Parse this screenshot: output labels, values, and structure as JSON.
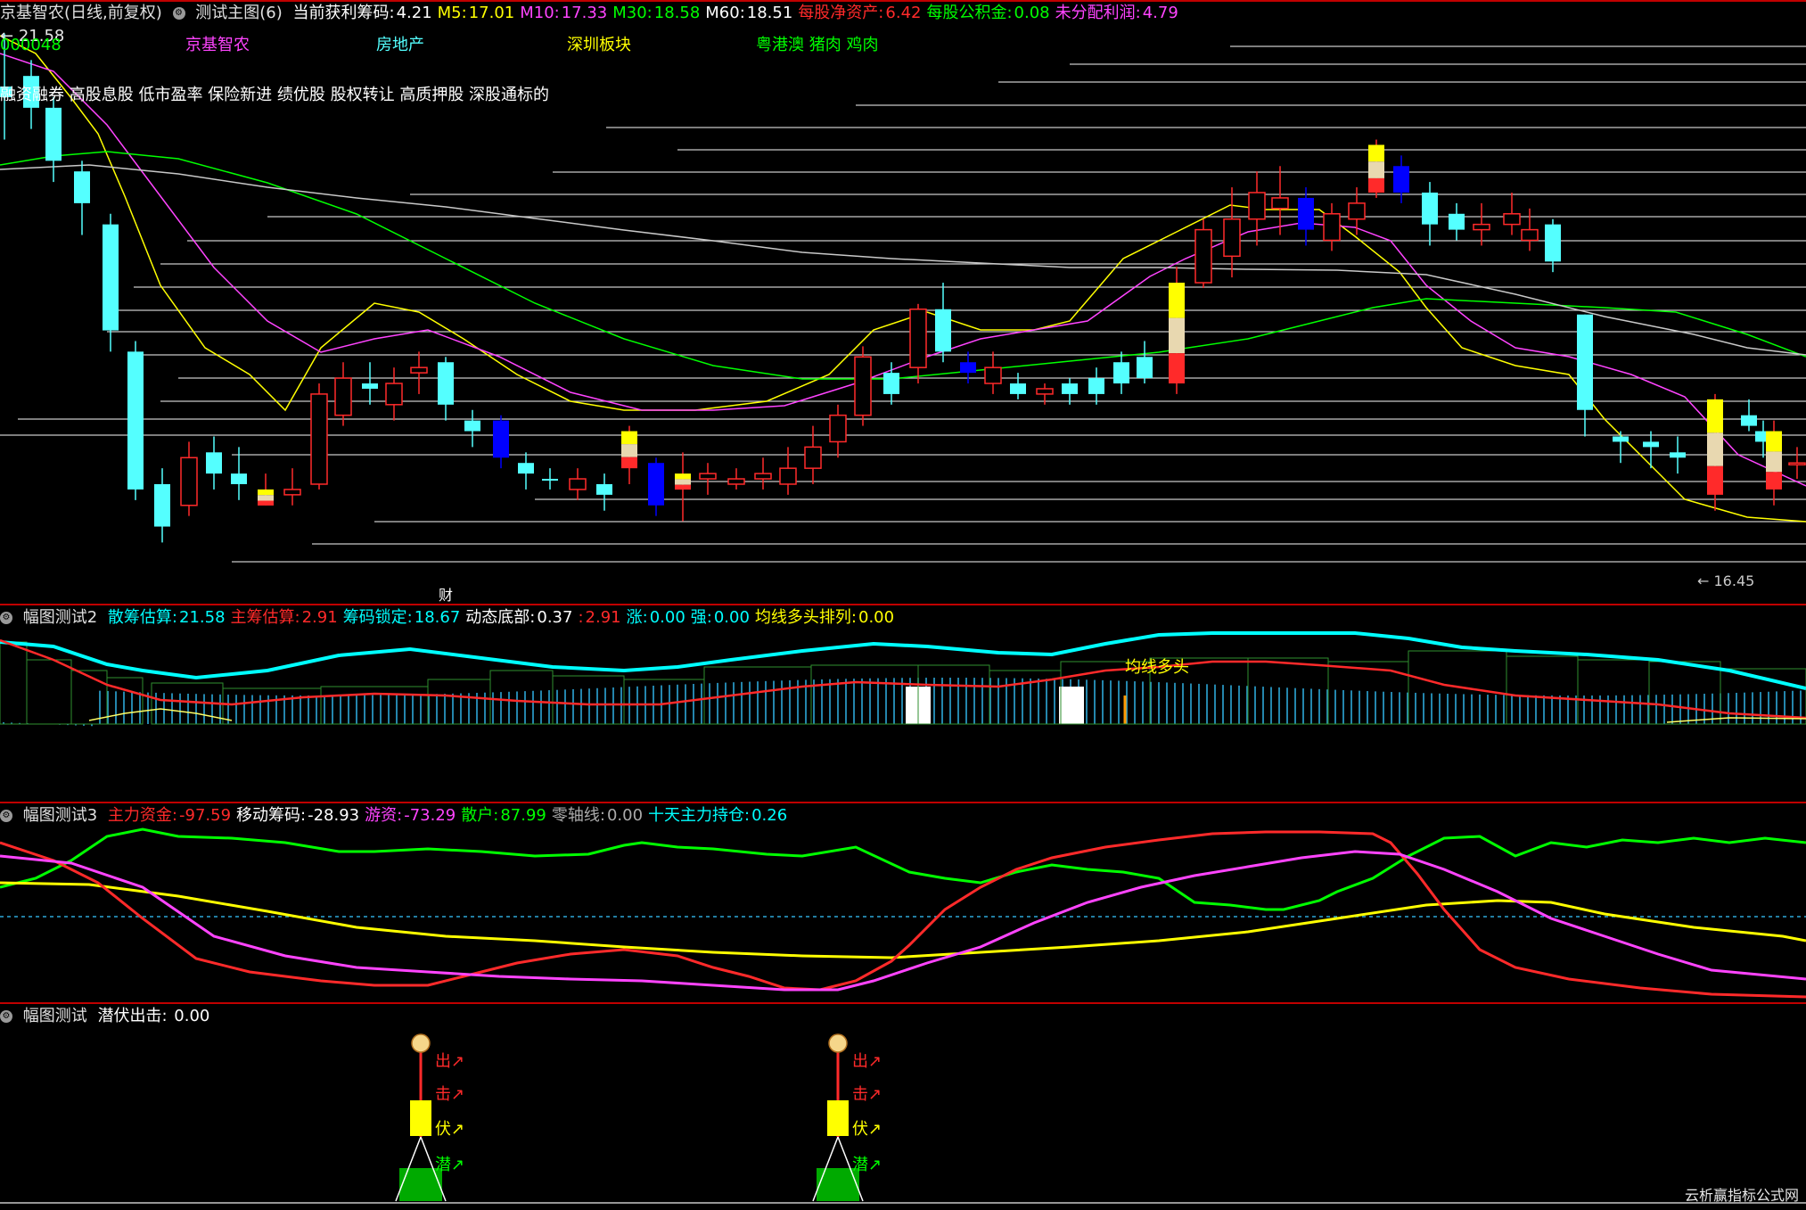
{
  "main": {
    "title": "京基智农(日线,前复权)",
    "indicator": "测试主图(6)",
    "fields": [
      {
        "label": "当前获利筹码:",
        "value": "4.21",
        "color": "#ffffff"
      },
      {
        "label": "M5:",
        "value": "17.01",
        "color": "#ffff00"
      },
      {
        "label": "M10:",
        "value": "17.33",
        "color": "#ff44ff"
      },
      {
        "label": "M30:",
        "value": "18.58",
        "color": "#00ff00"
      },
      {
        "label": "M60:",
        "value": "18.51",
        "color": "#ffffff"
      },
      {
        "label": "每股净资产:",
        "value": "6.42",
        "color": "#ff2a2a"
      },
      {
        "label": "每股公积金:",
        "value": "0.08",
        "color": "#00ff00"
      },
      {
        "label": "未分配利润:",
        "value": "4.79",
        "color": "#ff44ff"
      }
    ],
    "code_line": "000048",
    "sectors": [
      "京基智农",
      "房地产",
      "深圳板块",
      "粤港澳 猪肉 鸡肉"
    ],
    "concepts": "融资融券 高股息股 低市盈率 保险新进 绩优股 股权转让 高质押股 深股通标的",
    "high_label": "21.58",
    "low_label": "16.45",
    "fin_marker": "财"
  },
  "panel2": {
    "name": "幅图测试2",
    "fields": [
      {
        "label": "散筹估算:",
        "value": "21.58",
        "color": "#00ffff"
      },
      {
        "label": "主筹估算:",
        "value": "2.91",
        "color": "#ff2a2a"
      },
      {
        "label": "筹码锁定:",
        "value": "18.67",
        "color": "#00ffff"
      },
      {
        "label": "动态底部:",
        "value": "0.37",
        "color": "#ffffff"
      },
      {
        "label": ":",
        "value": "2.91",
        "color": "#ff2a2a"
      },
      {
        "label": "涨:",
        "value": "0.00",
        "color": "#00ffff"
      },
      {
        "label": "强:",
        "value": "0.00",
        "color": "#00ffff"
      },
      {
        "label": "均线多头排列:",
        "value": "0.00",
        "color": "#ffff00"
      }
    ],
    "annotation": "均线多头"
  },
  "panel3": {
    "name": "幅图测试3",
    "fields": [
      {
        "label": "主力资金:",
        "value": "-97.59",
        "color": "#ff2a2a"
      },
      {
        "label": "移动筹码:",
        "value": "-28.93",
        "color": "#ffffff"
      },
      {
        "label": "游资:",
        "value": "-73.29",
        "color": "#ff44ff"
      },
      {
        "label": "散户:",
        "value": "87.99",
        "color": "#00ff00"
      },
      {
        "label": "零轴线:",
        "value": "0.00",
        "color": "#aaaaaa"
      },
      {
        "label": "十天主力持仓:",
        "value": "0.26",
        "color": "#00ffff"
      }
    ]
  },
  "panel4": {
    "name": "幅图测试",
    "field": {
      "label": "潜伏出击:",
      "value": "0.00",
      "color": "#ffffff"
    },
    "signal_words": [
      "出",
      "击",
      "伏",
      "潜"
    ],
    "signal_icon": "money-bag-icon"
  },
  "watermark": "云析赢指标公式网",
  "colors": {
    "up": "#ff2a2a",
    "down_cyan": "#54ffff",
    "down_blue": "#0000ff",
    "ma5": "#ffff00",
    "ma10": "#ff44ff",
    "ma30": "#00ff00",
    "ma60": "#c8c8c8",
    "frame": "#c00000"
  }
}
